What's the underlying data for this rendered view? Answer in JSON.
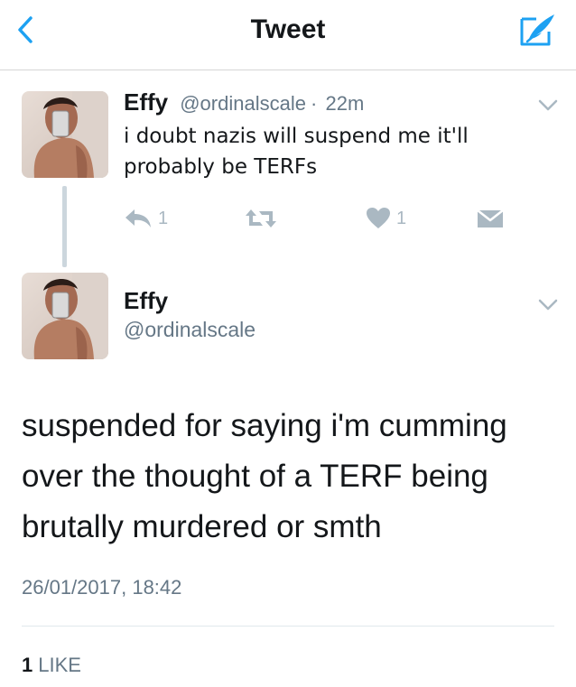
{
  "nav": {
    "title": "Tweet",
    "back_icon": "chevron-left-icon",
    "compose_icon": "compose-tweet-icon",
    "accent": "#1da1f2"
  },
  "parent_tweet": {
    "name": "Effy",
    "handle": "@ordinalscale",
    "separator": "·",
    "time": "22m",
    "text": "i doubt nazis will suspend me it'll probably be TERFs",
    "reply_count": "1",
    "like_count": "1",
    "icons": [
      "reply-icon",
      "retweet-icon",
      "heart-icon",
      "direct-message-icon",
      "chevron-down-icon"
    ]
  },
  "main_tweet": {
    "name": "Effy",
    "handle": "@ordinalscale",
    "text": "suspended for saying i'm cumming over the thought of a TERF being brutally murdered or smth",
    "timestamp": "26/01/2017, 18:42",
    "likes_count": "1",
    "likes_label": "LIKE"
  },
  "colors": {
    "text": "#14171a",
    "secondary": "#657786",
    "action_icons": "#aab8c2",
    "thread_line": "#ccd6dd"
  }
}
